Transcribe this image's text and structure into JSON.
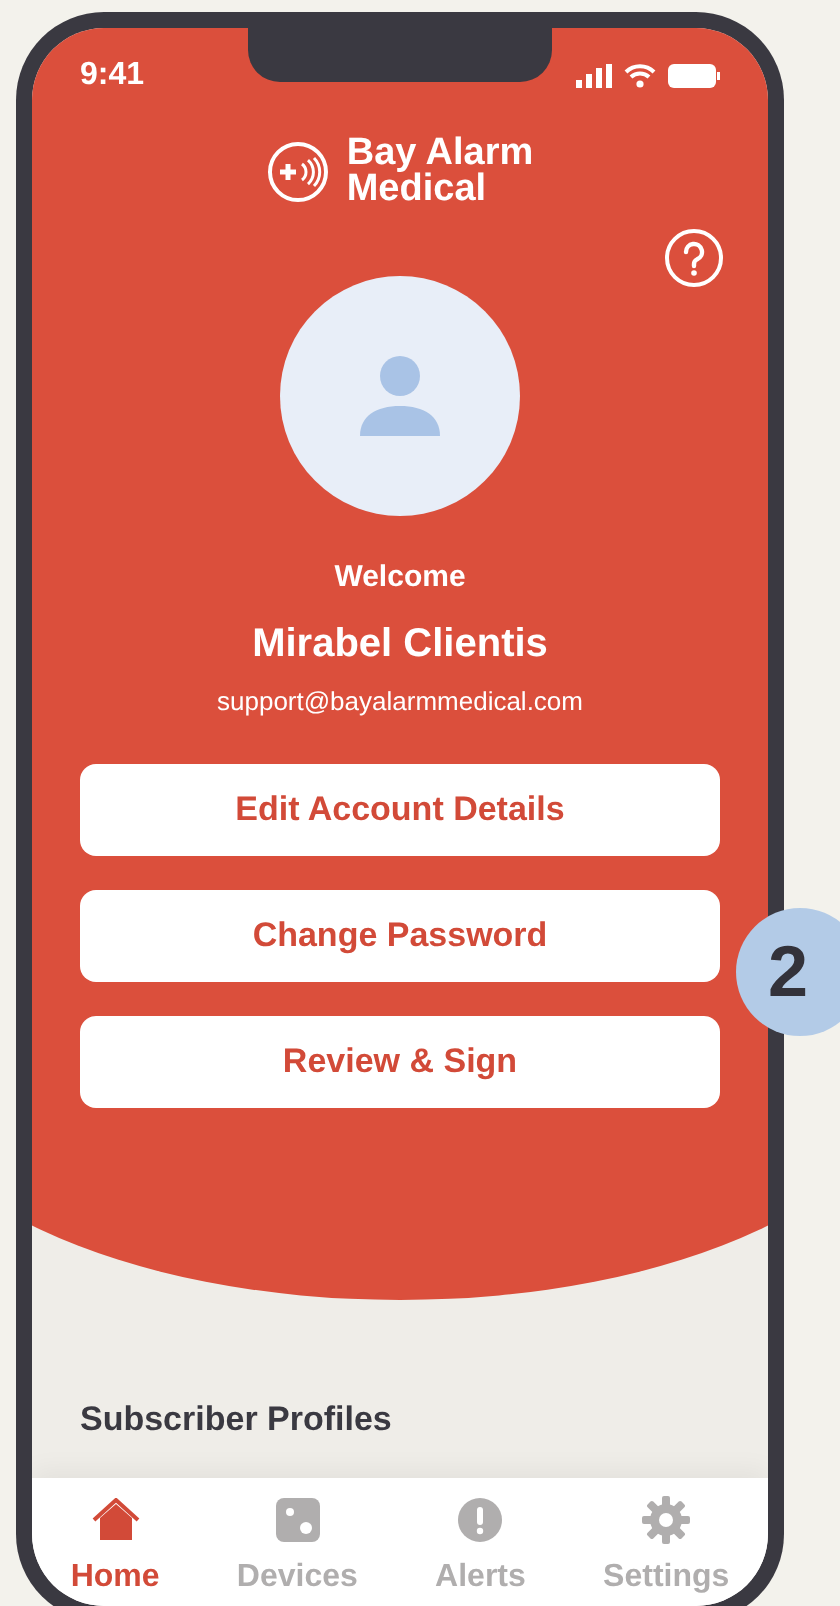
{
  "status_bar": {
    "time": "9:41"
  },
  "brand": {
    "line_1": "Bay Alarm",
    "line_2": "Medical"
  },
  "profile": {
    "greeting": "Welcome",
    "name": "Mirabel Clientis",
    "email": "support@bayalarmmedical.com"
  },
  "actions": [
    "Edit Account Details",
    "Change Password",
    "Review & Sign"
  ],
  "section_title": "Subscriber Profiles",
  "nav": [
    {
      "kind": "home",
      "label": "Home",
      "selected": true
    },
    {
      "kind": "devices",
      "label": "Devices",
      "selected": false
    },
    {
      "kind": "alerts",
      "label": "Alerts",
      "selected": false
    },
    {
      "kind": "settings",
      "label": "Settings",
      "selected": false
    }
  ],
  "callout": "2"
}
